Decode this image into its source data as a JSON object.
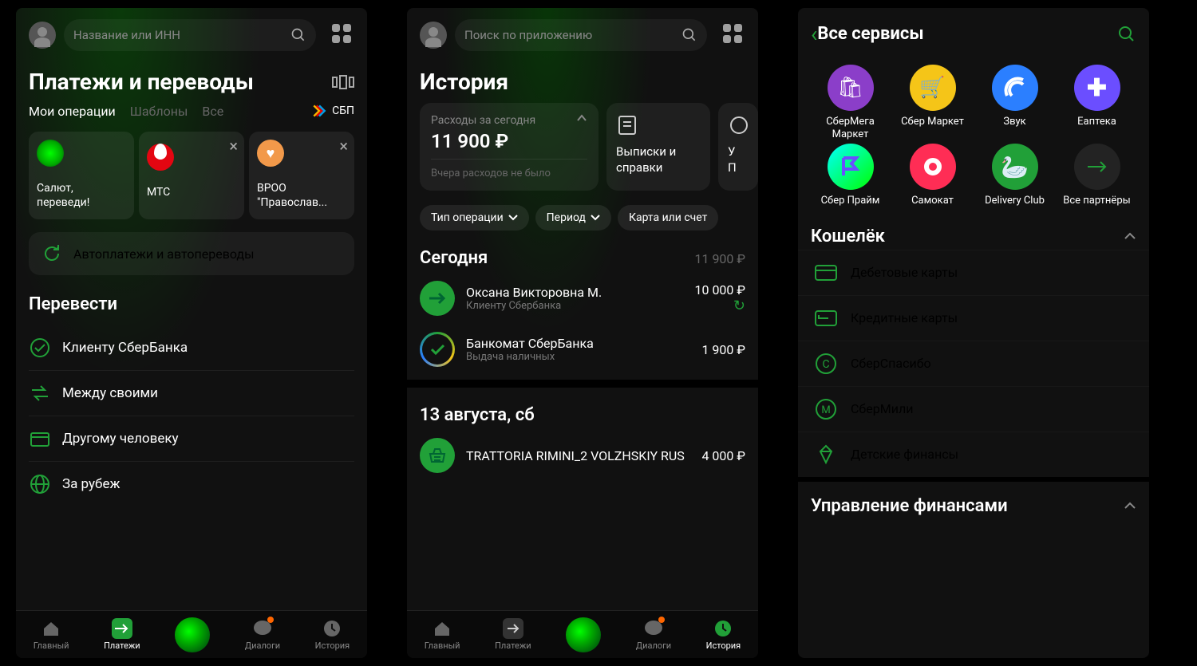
{
  "screen1": {
    "search_placeholder": "Название или ИНН",
    "title": "Платежи и переводы",
    "tabs": [
      "Мои операции",
      "Шаблоны",
      "Все"
    ],
    "sbp_label": "СБП",
    "quick": [
      {
        "label": "Салют, переведи!",
        "closable": false,
        "bg": "radial-gradient(circle,#0f0 0%,#0a0 60%,#031 100%)"
      },
      {
        "label": "МТС",
        "closable": true,
        "bg": "#e30611"
      },
      {
        "label": "ВРОО \"Православ...",
        "closable": true,
        "bg": "#f2994a"
      }
    ],
    "autopay": "Автоплатежи и автопереводы",
    "transfer_header": "Перевести",
    "transfer_items": [
      {
        "label": "Клиенту СберБанка",
        "icon": "check-circle"
      },
      {
        "label": "Между своими",
        "icon": "swap"
      },
      {
        "label": "Другому человеку",
        "icon": "card"
      },
      {
        "label": "За рубеж",
        "icon": "globe"
      }
    ]
  },
  "screen2": {
    "search_placeholder": "Поиск по приложению",
    "title": "История",
    "expense_label": "Расходы за сегодня",
    "expense_amount": "11 900 ₽",
    "expense_note": "Вчера расходов не было",
    "side1": "Выписки и справки",
    "side2": "У",
    "side2b": "П",
    "chips": [
      "Тип операции",
      "Период",
      "Карта или счет"
    ],
    "groups": [
      {
        "date": "Сегодня",
        "sum": "11 900 ₽",
        "tx": [
          {
            "title": "Оксана Викторовна М.",
            "sub": "Клиенту Сбербанка",
            "amount": "10 000 ₽",
            "bg": "#21A038",
            "refresh": true
          },
          {
            "title": "Банкомат СберБанка",
            "sub": "Выдача наличных",
            "amount": "1 900 ₽",
            "bg": "#fff"
          }
        ]
      },
      {
        "date": "13 августа, сб",
        "sum": "",
        "tx": [
          {
            "title": "TRATTORIA RIMINI_2 VOLZHSKIY RUS",
            "sub": "",
            "amount": "4 000 ₽",
            "bg": "#21A038"
          }
        ]
      }
    ]
  },
  "screen3": {
    "title": "Все сервисы",
    "services": [
      {
        "label": "СберМега Маркет",
        "bg": "#8b3ec9"
      },
      {
        "label": "Сбер Маркет",
        "bg": "#f5c518"
      },
      {
        "label": "Звук",
        "bg": "#2b7fff"
      },
      {
        "label": "Еаптека",
        "bg": "#6b4eff"
      },
      {
        "label": "Сбер Прайм",
        "bg": "linear-gradient(135deg,#0ff,#0f0)"
      },
      {
        "label": "Самокат",
        "bg": "#ff2d55"
      },
      {
        "label": "Delivery Club",
        "bg": "#21A038"
      },
      {
        "label": "Все партнёры",
        "bg": "rgba(255,255,255,0.08)"
      }
    ],
    "wallet_header": "Кошелёк",
    "wallet_items": [
      {
        "label": "Дебетовые карты",
        "icon": "card"
      },
      {
        "label": "Кредитные карты",
        "icon": "card-arrow"
      },
      {
        "label": "СберСпасибо",
        "icon": "C"
      },
      {
        "label": "СберМили",
        "icon": "M"
      },
      {
        "label": "Детские финансы",
        "icon": "diamond"
      }
    ],
    "finance_header": "Управление финансами"
  },
  "nav": {
    "items": [
      {
        "label": "Главный",
        "icon": "home"
      },
      {
        "label": "Платежи",
        "icon": "arrow"
      },
      {
        "label": "",
        "icon": "center"
      },
      {
        "label": "Диалоги",
        "icon": "chat",
        "badge": true
      },
      {
        "label": "История",
        "icon": "clock"
      }
    ]
  }
}
